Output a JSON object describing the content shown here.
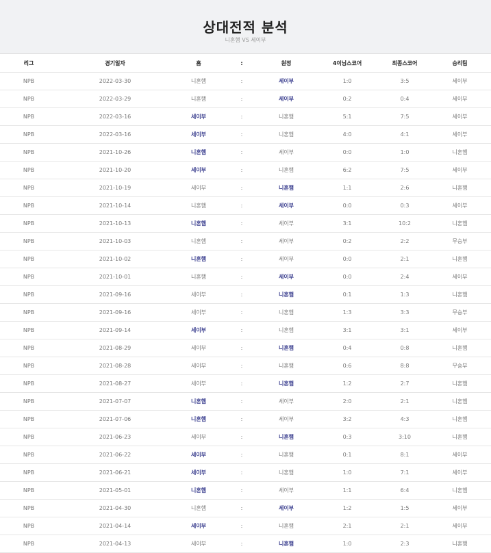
{
  "page": {
    "title": "상대전적 분석",
    "subtitle": "니혼햄 VS 세이부"
  },
  "columns": [
    "리그",
    "경기일자",
    "홈",
    ":",
    "원정",
    "4이닝스코어",
    "최종스코어",
    "승리팀"
  ],
  "rows": [
    {
      "league": "NPB",
      "date": "2022-03-30",
      "home": "니혼햄",
      "sep": ":",
      "away": "세이부",
      "score4": "1:0",
      "final": "3:5",
      "winner": "세이부"
    },
    {
      "league": "NPB",
      "date": "2022-03-29",
      "home": "니혼햄",
      "sep": ":",
      "away": "세이부",
      "score4": "0:2",
      "final": "0:4",
      "winner": "세이부"
    },
    {
      "league": "NPB",
      "date": "2022-03-16",
      "home": "세이부",
      "sep": ":",
      "away": "니혼햄",
      "score4": "5:1",
      "final": "7:5",
      "winner": "세이부"
    },
    {
      "league": "NPB",
      "date": "2022-03-16",
      "home": "세이부",
      "sep": ":",
      "away": "니혼햄",
      "score4": "4:0",
      "final": "4:1",
      "winner": "세이부"
    },
    {
      "league": "NPB",
      "date": "2021-10-26",
      "home": "니혼햄",
      "sep": ":",
      "away": "세이부",
      "score4": "0:0",
      "final": "1:0",
      "winner": "니혼햄"
    },
    {
      "league": "NPB",
      "date": "2021-10-20",
      "home": "세이부",
      "sep": ":",
      "away": "니혼햄",
      "score4": "6:2",
      "final": "7:5",
      "winner": "세이부"
    },
    {
      "league": "NPB",
      "date": "2021-10-19",
      "home": "세이부",
      "sep": ":",
      "away": "니혼햄",
      "score4": "1:1",
      "final": "2:6",
      "winner": "니혼햄"
    },
    {
      "league": "NPB",
      "date": "2021-10-14",
      "home": "니혼햄",
      "sep": ":",
      "away": "세이부",
      "score4": "0:0",
      "final": "0:3",
      "winner": "세이부"
    },
    {
      "league": "NPB",
      "date": "2021-10-13",
      "home": "니혼햄",
      "sep": ":",
      "away": "세이부",
      "score4": "3:1",
      "final": "10:2",
      "winner": "니혼햄"
    },
    {
      "league": "NPB",
      "date": "2021-10-03",
      "home": "니혼햄",
      "sep": ":",
      "away": "세이부",
      "score4": "0:2",
      "final": "2:2",
      "winner": "무승부"
    },
    {
      "league": "NPB",
      "date": "2021-10-02",
      "home": "니혼햄",
      "sep": ":",
      "away": "세이부",
      "score4": "0:0",
      "final": "2:1",
      "winner": "니혼햄"
    },
    {
      "league": "NPB",
      "date": "2021-10-01",
      "home": "니혼햄",
      "sep": ":",
      "away": "세이부",
      "score4": "0:0",
      "final": "2:4",
      "winner": "세이부"
    },
    {
      "league": "NPB",
      "date": "2021-09-16",
      "home": "세이부",
      "sep": ":",
      "away": "니혼햄",
      "score4": "0:1",
      "final": "1:3",
      "winner": "니혼햄"
    },
    {
      "league": "NPB",
      "date": "2021-09-16",
      "home": "세이부",
      "sep": ":",
      "away": "니혼햄",
      "score4": "1:3",
      "final": "3:3",
      "winner": "무승부"
    },
    {
      "league": "NPB",
      "date": "2021-09-14",
      "home": "세이부",
      "sep": ":",
      "away": "니혼햄",
      "score4": "3:1",
      "final": "3:1",
      "winner": "세이부"
    },
    {
      "league": "NPB",
      "date": "2021-08-29",
      "home": "세이부",
      "sep": ":",
      "away": "니혼햄",
      "score4": "0:4",
      "final": "0:8",
      "winner": "니혼햄"
    },
    {
      "league": "NPB",
      "date": "2021-08-28",
      "home": "세이부",
      "sep": ":",
      "away": "니혼햄",
      "score4": "0:6",
      "final": "8:8",
      "winner": "무승부"
    },
    {
      "league": "NPB",
      "date": "2021-08-27",
      "home": "세이부",
      "sep": ":",
      "away": "니혼햄",
      "score4": "1:2",
      "final": "2:7",
      "winner": "니혼햄"
    },
    {
      "league": "NPB",
      "date": "2021-07-07",
      "home": "니혼햄",
      "sep": ":",
      "away": "세이부",
      "score4": "2:0",
      "final": "2:1",
      "winner": "니혼햄"
    },
    {
      "league": "NPB",
      "date": "2021-07-06",
      "home": "니혼햄",
      "sep": ":",
      "away": "세이부",
      "score4": "3:2",
      "final": "4:3",
      "winner": "니혼햄"
    },
    {
      "league": "NPB",
      "date": "2021-06-23",
      "home": "세이부",
      "sep": ":",
      "away": "니혼햄",
      "score4": "0:3",
      "final": "3:10",
      "winner": "니혼햄"
    },
    {
      "league": "NPB",
      "date": "2021-06-22",
      "home": "세이부",
      "sep": ":",
      "away": "니혼햄",
      "score4": "0:1",
      "final": "8:1",
      "winner": "세이부"
    },
    {
      "league": "NPB",
      "date": "2021-06-21",
      "home": "세이부",
      "sep": ":",
      "away": "니혼햄",
      "score4": "1:0",
      "final": "7:1",
      "winner": "세이부"
    },
    {
      "league": "NPB",
      "date": "2021-05-01",
      "home": "니혼햄",
      "sep": ":",
      "away": "세이부",
      "score4": "1:1",
      "final": "6:4",
      "winner": "니혼햄"
    },
    {
      "league": "NPB",
      "date": "2021-04-30",
      "home": "니혼햄",
      "sep": ":",
      "away": "세이부",
      "score4": "1:2",
      "final": "1:5",
      "winner": "세이부"
    },
    {
      "league": "NPB",
      "date": "2021-04-14",
      "home": "세이부",
      "sep": ":",
      "away": "니혼햄",
      "score4": "2:1",
      "final": "2:1",
      "winner": "세이부"
    },
    {
      "league": "NPB",
      "date": "2021-04-13",
      "home": "세이부",
      "sep": ":",
      "away": "니혼햄",
      "score4": "1:0",
      "final": "2:3",
      "winner": "니혼햄"
    }
  ]
}
